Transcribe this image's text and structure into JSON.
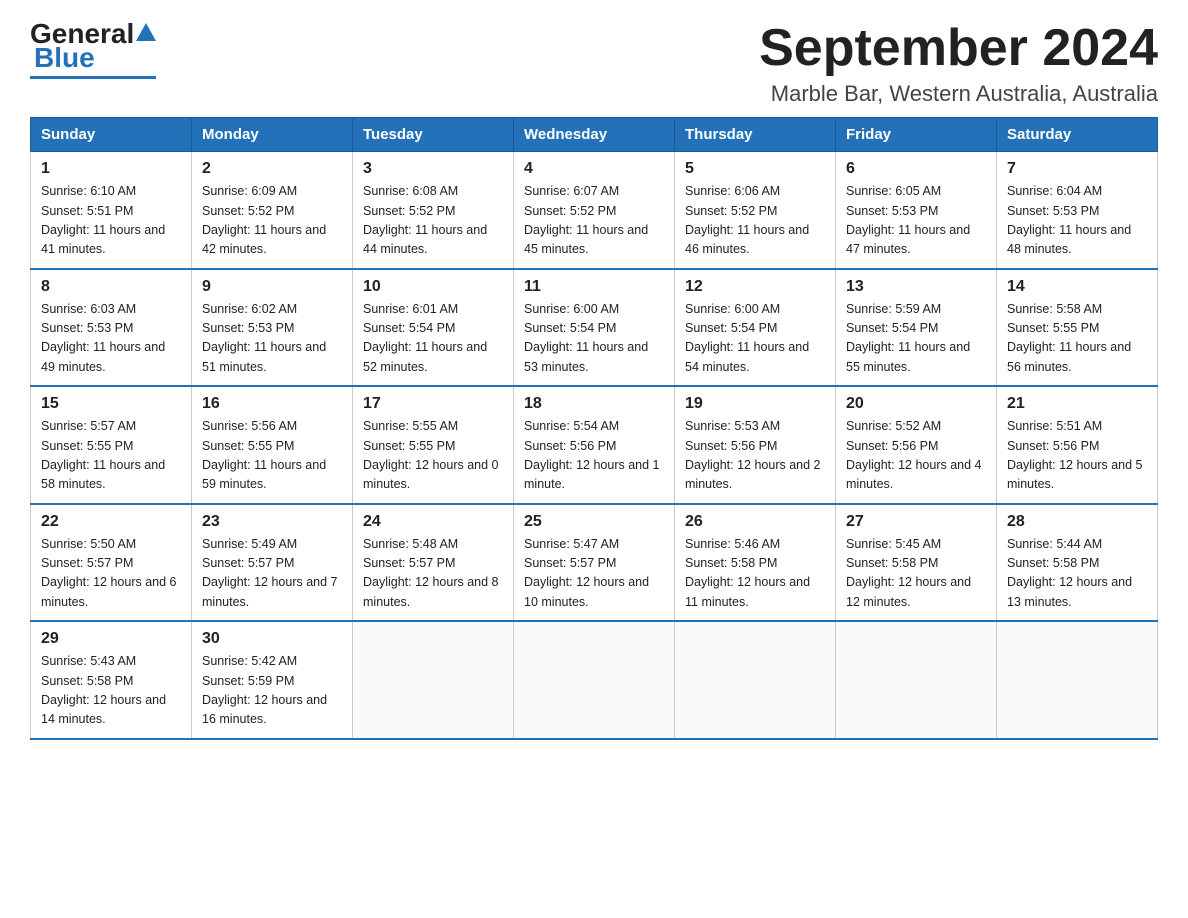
{
  "logo": {
    "general": "General",
    "blue": "Blue"
  },
  "header": {
    "title": "September 2024",
    "subtitle": "Marble Bar, Western Australia, Australia"
  },
  "days_of_week": [
    "Sunday",
    "Monday",
    "Tuesday",
    "Wednesday",
    "Thursday",
    "Friday",
    "Saturday"
  ],
  "weeks": [
    [
      {
        "day": "1",
        "sunrise": "6:10 AM",
        "sunset": "5:51 PM",
        "daylight": "11 hours and 41 minutes."
      },
      {
        "day": "2",
        "sunrise": "6:09 AM",
        "sunset": "5:52 PM",
        "daylight": "11 hours and 42 minutes."
      },
      {
        "day": "3",
        "sunrise": "6:08 AM",
        "sunset": "5:52 PM",
        "daylight": "11 hours and 44 minutes."
      },
      {
        "day": "4",
        "sunrise": "6:07 AM",
        "sunset": "5:52 PM",
        "daylight": "11 hours and 45 minutes."
      },
      {
        "day": "5",
        "sunrise": "6:06 AM",
        "sunset": "5:52 PM",
        "daylight": "11 hours and 46 minutes."
      },
      {
        "day": "6",
        "sunrise": "6:05 AM",
        "sunset": "5:53 PM",
        "daylight": "11 hours and 47 minutes."
      },
      {
        "day": "7",
        "sunrise": "6:04 AM",
        "sunset": "5:53 PM",
        "daylight": "11 hours and 48 minutes."
      }
    ],
    [
      {
        "day": "8",
        "sunrise": "6:03 AM",
        "sunset": "5:53 PM",
        "daylight": "11 hours and 49 minutes."
      },
      {
        "day": "9",
        "sunrise": "6:02 AM",
        "sunset": "5:53 PM",
        "daylight": "11 hours and 51 minutes."
      },
      {
        "day": "10",
        "sunrise": "6:01 AM",
        "sunset": "5:54 PM",
        "daylight": "11 hours and 52 minutes."
      },
      {
        "day": "11",
        "sunrise": "6:00 AM",
        "sunset": "5:54 PM",
        "daylight": "11 hours and 53 minutes."
      },
      {
        "day": "12",
        "sunrise": "6:00 AM",
        "sunset": "5:54 PM",
        "daylight": "11 hours and 54 minutes."
      },
      {
        "day": "13",
        "sunrise": "5:59 AM",
        "sunset": "5:54 PM",
        "daylight": "11 hours and 55 minutes."
      },
      {
        "day": "14",
        "sunrise": "5:58 AM",
        "sunset": "5:55 PM",
        "daylight": "11 hours and 56 minutes."
      }
    ],
    [
      {
        "day": "15",
        "sunrise": "5:57 AM",
        "sunset": "5:55 PM",
        "daylight": "11 hours and 58 minutes."
      },
      {
        "day": "16",
        "sunrise": "5:56 AM",
        "sunset": "5:55 PM",
        "daylight": "11 hours and 59 minutes."
      },
      {
        "day": "17",
        "sunrise": "5:55 AM",
        "sunset": "5:55 PM",
        "daylight": "12 hours and 0 minutes."
      },
      {
        "day": "18",
        "sunrise": "5:54 AM",
        "sunset": "5:56 PM",
        "daylight": "12 hours and 1 minute."
      },
      {
        "day": "19",
        "sunrise": "5:53 AM",
        "sunset": "5:56 PM",
        "daylight": "12 hours and 2 minutes."
      },
      {
        "day": "20",
        "sunrise": "5:52 AM",
        "sunset": "5:56 PM",
        "daylight": "12 hours and 4 minutes."
      },
      {
        "day": "21",
        "sunrise": "5:51 AM",
        "sunset": "5:56 PM",
        "daylight": "12 hours and 5 minutes."
      }
    ],
    [
      {
        "day": "22",
        "sunrise": "5:50 AM",
        "sunset": "5:57 PM",
        "daylight": "12 hours and 6 minutes."
      },
      {
        "day": "23",
        "sunrise": "5:49 AM",
        "sunset": "5:57 PM",
        "daylight": "12 hours and 7 minutes."
      },
      {
        "day": "24",
        "sunrise": "5:48 AM",
        "sunset": "5:57 PM",
        "daylight": "12 hours and 8 minutes."
      },
      {
        "day": "25",
        "sunrise": "5:47 AM",
        "sunset": "5:57 PM",
        "daylight": "12 hours and 10 minutes."
      },
      {
        "day": "26",
        "sunrise": "5:46 AM",
        "sunset": "5:58 PM",
        "daylight": "12 hours and 11 minutes."
      },
      {
        "day": "27",
        "sunrise": "5:45 AM",
        "sunset": "5:58 PM",
        "daylight": "12 hours and 12 minutes."
      },
      {
        "day": "28",
        "sunrise": "5:44 AM",
        "sunset": "5:58 PM",
        "daylight": "12 hours and 13 minutes."
      }
    ],
    [
      {
        "day": "29",
        "sunrise": "5:43 AM",
        "sunset": "5:58 PM",
        "daylight": "12 hours and 14 minutes."
      },
      {
        "day": "30",
        "sunrise": "5:42 AM",
        "sunset": "5:59 PM",
        "daylight": "12 hours and 16 minutes."
      },
      null,
      null,
      null,
      null,
      null
    ]
  ]
}
